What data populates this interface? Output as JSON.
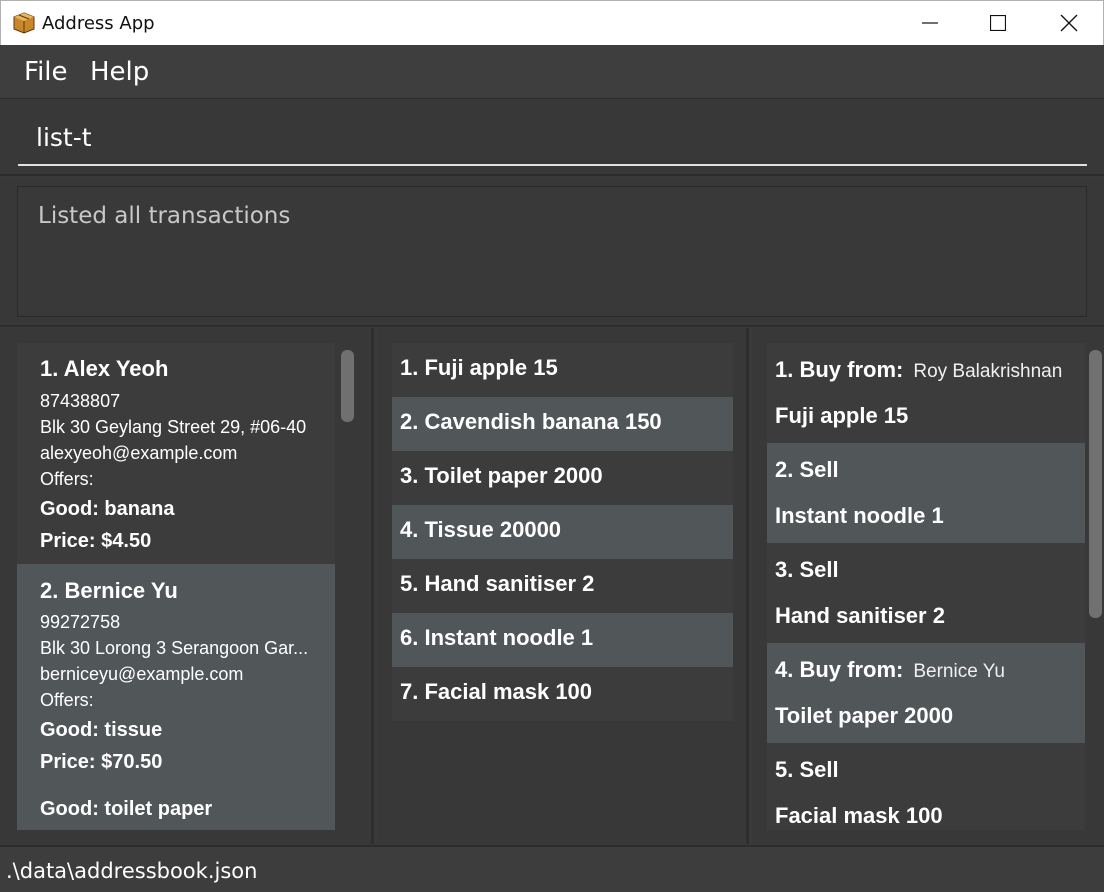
{
  "window": {
    "title": "Address App",
    "controls": [
      "minimize-icon",
      "maximize-icon",
      "close-icon"
    ]
  },
  "menu": [
    "File",
    "Help"
  ],
  "command": {
    "value": "list-t"
  },
  "result": {
    "text": "Listed all transactions"
  },
  "persons": [
    {
      "name": "1.  Alex Yeoh",
      "phone": "87438807",
      "address": "Blk 30 Geylang Street 29, #06-40",
      "email": "alexyeoh@example.com",
      "offers_label": "Offers:",
      "offers": [
        {
          "good": "Good: banana",
          "price": "Price: $4.50"
        }
      ]
    },
    {
      "name": "2.  Bernice Yu",
      "phone": "99272758",
      "address": "Blk 30 Lorong 3 Serangoon Gar...",
      "email": "berniceyu@example.com",
      "offers_label": "Offers:",
      "offers": [
        {
          "good": "Good: tissue",
          "price": "Price: $70.50"
        },
        {
          "good": "Good: toilet paper"
        }
      ]
    }
  ],
  "goods": [
    "1.  Fuji apple 15",
    "2.  Cavendish banana 150",
    "3.  Toilet paper 2000",
    "4.  Tissue 20000",
    "5.  Hand sanitiser 2",
    "6.  Instant noodle 1",
    "7.  Facial mask 100"
  ],
  "transactions": [
    {
      "head": "1.  Buy from:",
      "party": "Roy Balakrishnan",
      "good": "Fuji apple 15"
    },
    {
      "head": "2.  Sell",
      "party": "",
      "good": "Instant noodle 1"
    },
    {
      "head": "3.  Sell",
      "party": "",
      "good": "Hand sanitiser 2"
    },
    {
      "head": "4.  Buy from:",
      "party": "Bernice Yu",
      "good": "Toilet paper 2000"
    },
    {
      "head": "5.  Sell",
      "party": "",
      "good": "Facial mask 100"
    }
  ],
  "status": {
    "path": ".\\data\\addressbook.json"
  },
  "colors": {
    "background": "#383838",
    "row_dark": "#3c3c3c",
    "row_light": "#515658"
  }
}
